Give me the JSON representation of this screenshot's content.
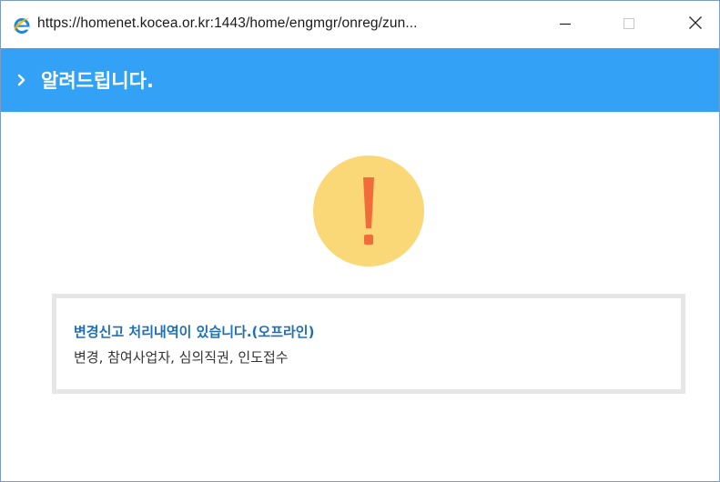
{
  "window": {
    "url": "https://homenet.kocea.or.kr:1443/home/engmgr/onreg/zun...",
    "browser_icon": "internet-explorer-icon",
    "controls": {
      "minimize": "minimize-icon",
      "maximize": "maximize-icon",
      "close": "close-icon"
    }
  },
  "header": {
    "title": "알려드립니다.",
    "accent_color": "#33a2f6",
    "icon": "chevron-right-icon"
  },
  "alert": {
    "icon": "exclamation-icon",
    "circle_color": "#fbd877",
    "mark_color": "#f26b3a"
  },
  "message": {
    "title": "변경신고 처리내역이 있습니다.(오프라인)",
    "detail": "변경, 참여사업자, 심의직권, 인도접수",
    "title_color": "#1d6fb5"
  }
}
